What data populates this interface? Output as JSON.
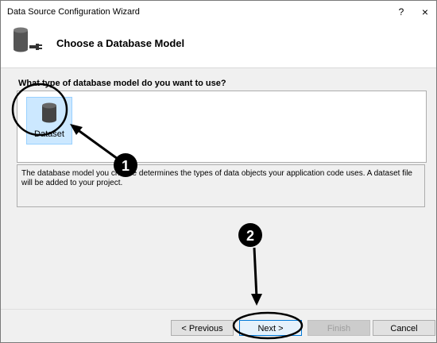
{
  "window": {
    "title": "Data Source Configuration Wizard",
    "help_label": "?",
    "close_label": "×"
  },
  "header": {
    "title": "Choose a Database Model",
    "icon": "database-plug-icon"
  },
  "main": {
    "question": "What type of database model do you want to use?",
    "models": [
      {
        "label": "Dataset",
        "icon": "database-icon",
        "selected": true
      }
    ],
    "description": "The database model you choose determines the types of data objects your application code uses. A dataset file will be added to your project."
  },
  "buttons": {
    "previous": "< Previous",
    "next": "Next >",
    "finish": "Finish",
    "cancel": "Cancel"
  },
  "annotations": {
    "badge1": "1",
    "badge2": "2"
  },
  "colors": {
    "selection": "#cce8ff",
    "accent": "#0078d7"
  }
}
